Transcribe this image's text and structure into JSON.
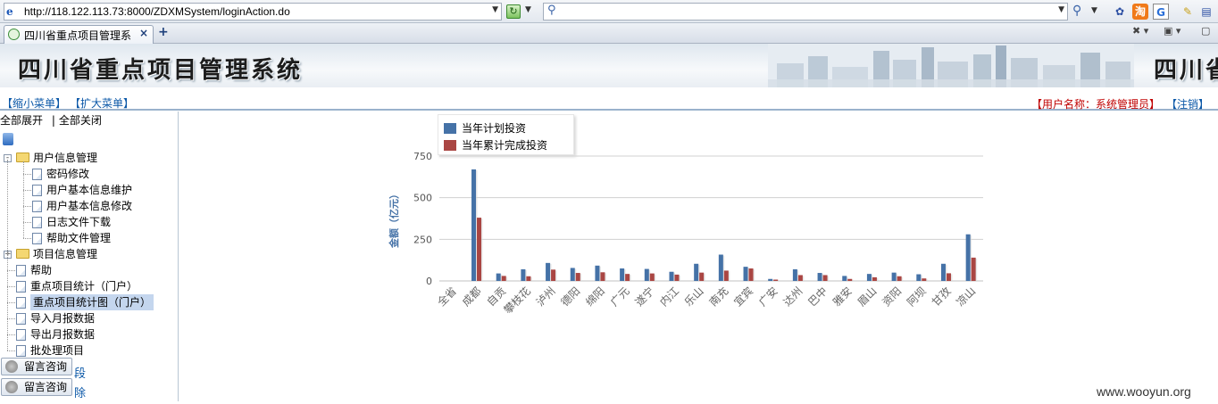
{
  "browser": {
    "url": "http://118.122.113.73:8000/ZDXMSystem/loginAction.do",
    "search_value": "",
    "tab_title": "四川省重点项目管理系",
    "new_tab_symbol": "+",
    "close_symbol": "×",
    "toolbar_icons": [
      "paw-icon",
      "taobao-icon",
      "google-icon",
      "highlight-icon",
      "menu-icon"
    ]
  },
  "header": {
    "title": "四川省重点项目管理系统",
    "title_repeat": "四川省"
  },
  "userbar": {
    "shrink_menu": "【缩小菜单】",
    "expand_menu": "【扩大菜单】",
    "user_label": "【用户名称：系统管理员】",
    "logout": "【注销】"
  },
  "tree": {
    "expand_all": "全部展开",
    "separator": "|",
    "collapse_all": "全部关闭",
    "nodes": [
      {
        "label": "用户信息管理",
        "type": "folder",
        "state": "-"
      },
      {
        "label": "密码修改",
        "type": "doc"
      },
      {
        "label": "用户基本信息维护",
        "type": "doc"
      },
      {
        "label": "用户基本信息修改",
        "type": "doc"
      },
      {
        "label": "日志文件下载",
        "type": "doc"
      },
      {
        "label": "帮助文件管理",
        "type": "doc"
      },
      {
        "label": "项目信息管理",
        "type": "folder",
        "state": "+"
      },
      {
        "label": "帮助",
        "type": "doc"
      },
      {
        "label": "重点项目统计（门户）",
        "type": "doc"
      },
      {
        "label": "重点项目统计图（门户）",
        "type": "doc",
        "selected": true
      },
      {
        "label": "导入月报数据",
        "type": "doc"
      },
      {
        "label": "导出月报数据",
        "type": "doc"
      },
      {
        "label": "批处理项目",
        "type": "doc"
      }
    ],
    "msg_buttons": [
      "留言咨询",
      "留言咨询"
    ],
    "tail_fragments": [
      "段",
      "除"
    ]
  },
  "chart_data": {
    "type": "bar",
    "ylabel": "金额（亿元）",
    "ylim": [
      0,
      750
    ],
    "yticks": [
      0,
      250,
      500,
      750
    ],
    "grid": true,
    "legend_position": "top-left",
    "categories": [
      "全省",
      "成都",
      "自贡",
      "攀枝花",
      "泸州",
      "德阳",
      "绵阳",
      "广元",
      "遂宁",
      "内江",
      "乐山",
      "南充",
      "宜宾",
      "广安",
      "达州",
      "巴中",
      "雅安",
      "眉山",
      "资阳",
      "阿坝",
      "甘孜",
      "凉山"
    ],
    "series": [
      {
        "name": "当年计划投资",
        "color": "#4572a7",
        "values": [
          0,
          670,
          45,
          70,
          108,
          78,
          92,
          75,
          72,
          55,
          103,
          158,
          85,
          12,
          70,
          48,
          30,
          42,
          50,
          40,
          103,
          280
        ]
      },
      {
        "name": "当年累计完成投资",
        "color": "#aa4643",
        "values": [
          0,
          380,
          30,
          28,
          68,
          48,
          52,
          42,
          45,
          38,
          50,
          62,
          75,
          8,
          35,
          35,
          12,
          22,
          28,
          15,
          46,
          140
        ]
      }
    ]
  },
  "watermark": "www.wooyun.org"
}
